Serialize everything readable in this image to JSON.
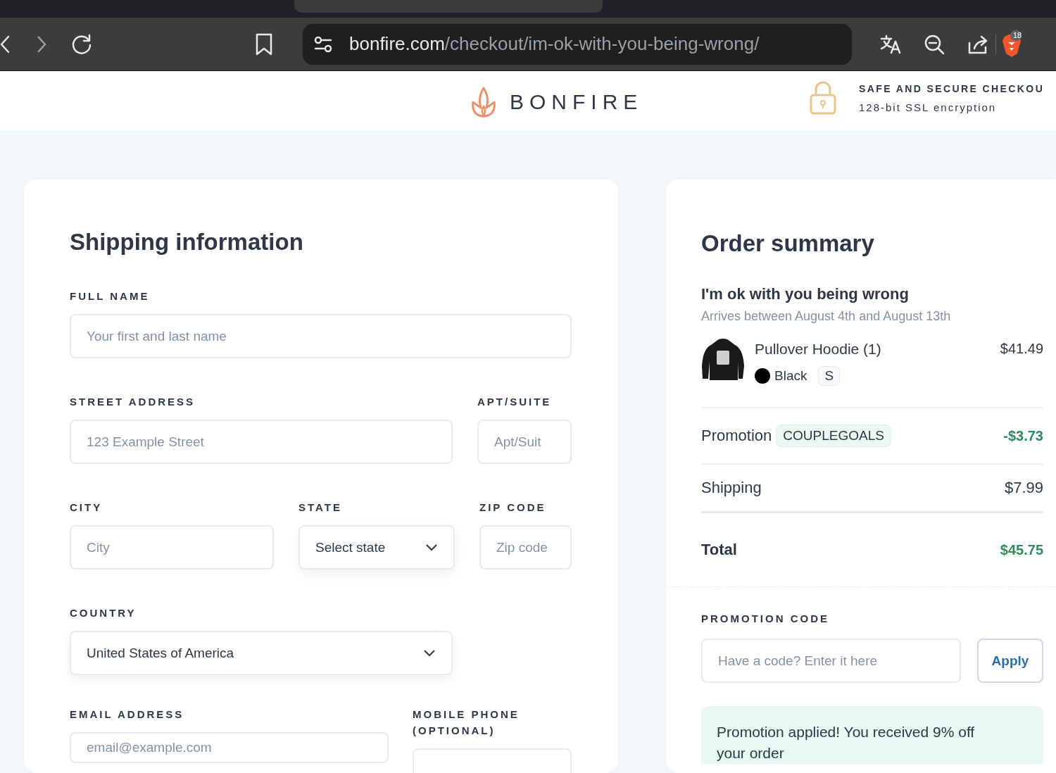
{
  "browser": {
    "url_host": "bonfire.com",
    "url_path": "/checkout/im-ok-with-you-being-wrong/",
    "extension_badge": "18"
  },
  "header": {
    "logo": "BONFIRE",
    "secure_title": "SAFE AND SECURE CHECKOU",
    "secure_subtitle": "128-bit SSL encryption"
  },
  "shipping": {
    "title": "Shipping information",
    "rows": [
      [
        {
          "label": "FULL NAME",
          "placeholder": "Your first and last name",
          "kind": "input"
        }
      ],
      [
        {
          "label": "STREET ADDRESS",
          "placeholder": "123 Example Street",
          "kind": "input"
        },
        {
          "label": "APT/SUITE",
          "placeholder": "Apt/Suit",
          "kind": "input"
        }
      ],
      [
        {
          "label": "CITY",
          "placeholder": "City",
          "kind": "input"
        },
        {
          "label": "STATE",
          "value": "Select state",
          "kind": "select"
        },
        {
          "label": "ZIP CODE",
          "placeholder": "Zip code",
          "kind": "input"
        }
      ],
      [
        {
          "label": "COUNTRY",
          "value": "United States of America",
          "kind": "select"
        }
      ],
      [
        {
          "label": "EMAIL ADDRESS",
          "placeholder": "email@example.com",
          "kind": "input"
        },
        {
          "label": "MOBILE PHONE (OPTIONAL)",
          "kind": "input"
        }
      ]
    ]
  },
  "summary": {
    "title": "Order summary",
    "product_title": "I'm ok with you being wrong",
    "arrival": "Arrives between August 4th and August 13th",
    "item": {
      "name": "Pullover Hoodie (1)",
      "price": "$41.49",
      "color_name": "Black",
      "color": "#000000",
      "size": "S"
    },
    "lines": [
      {
        "kind": "promotion",
        "label": "Promotion",
        "code": "COUPLEGOALS",
        "amount": "-$3.73"
      },
      {
        "kind": "plain",
        "label": "Shipping",
        "amount": "$7.99"
      }
    ],
    "total": {
      "label": "Total",
      "amount": "$45.75"
    },
    "promo": {
      "label": "PROMOTION CODE",
      "placeholder": "Have a code? Enter it here",
      "button": "Apply",
      "message": "Promotion applied! You received 9% off your order"
    }
  }
}
